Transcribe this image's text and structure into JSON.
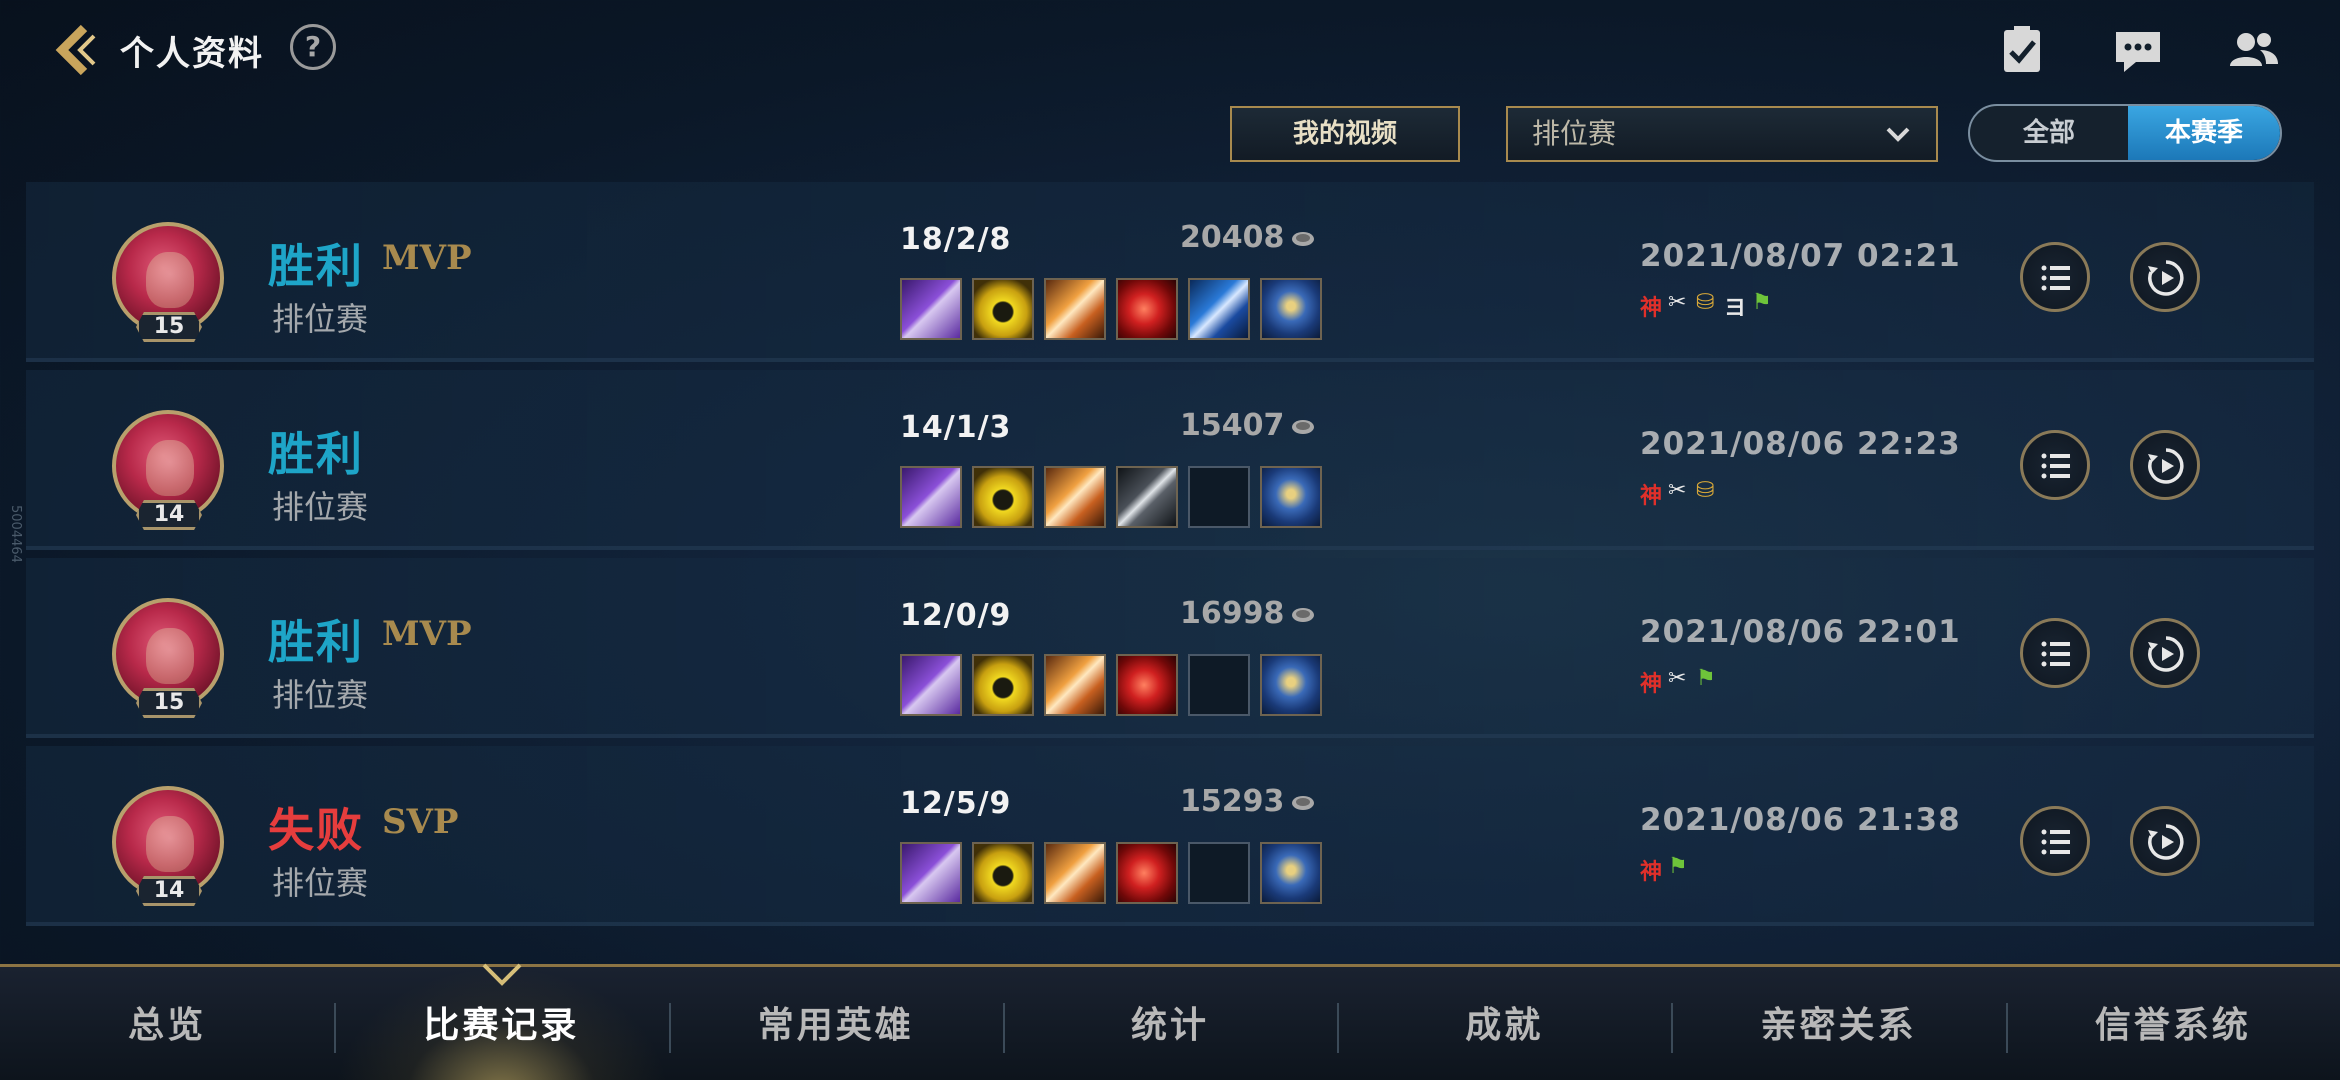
{
  "header": {
    "title": "个人资料",
    "help_label": "?",
    "icons": [
      "clipboard-check-icon",
      "chat-bubble-icon",
      "friends-icon"
    ]
  },
  "filters": {
    "my_videos_label": "我的视频",
    "mode_selected": "排位赛",
    "toggle": {
      "all_label": "全部",
      "season_label": "本赛季",
      "selected": "本赛季"
    }
  },
  "matches": [
    {
      "result": "胜利",
      "outcome": "win",
      "badge": "MVP",
      "mode": "排位赛",
      "level": "15",
      "kda": "18/2/8",
      "gold": "20408",
      "date": "2021/08/07 02:21",
      "items": [
        "purple-blade",
        "yellow-triangle",
        "orange-wings",
        "red-claw",
        "blue-lance",
        "blue-trinket"
      ],
      "tags": [
        {
          "text": "神",
          "color": "#e0302a"
        },
        {
          "text": "✂",
          "color": "#e8e8e8"
        },
        {
          "text": "⛁",
          "color": "#d8a838"
        },
        {
          "text": "ヨ",
          "color": "#e8e8e8"
        },
        {
          "text": "⚑",
          "color": "#6ec43a"
        }
      ]
    },
    {
      "result": "胜利",
      "outcome": "win",
      "badge": "",
      "mode": "排位赛",
      "level": "14",
      "kda": "14/1/3",
      "gold": "15407",
      "date": "2021/08/06 22:23",
      "items": [
        "purple-blade",
        "yellow-triangle",
        "orange-wings",
        "grey-sword",
        "empty",
        "blue-trinket"
      ],
      "tags": [
        {
          "text": "神",
          "color": "#e0302a"
        },
        {
          "text": "✂",
          "color": "#e8e8e8"
        },
        {
          "text": "⛁",
          "color": "#d8a838"
        }
      ]
    },
    {
      "result": "胜利",
      "outcome": "win",
      "badge": "MVP",
      "mode": "排位赛",
      "level": "15",
      "kda": "12/0/9",
      "gold": "16998",
      "date": "2021/08/06 22:01",
      "items": [
        "purple-blade",
        "yellow-triangle",
        "orange-wings",
        "red-claw",
        "empty",
        "blue-trinket"
      ],
      "tags": [
        {
          "text": "神",
          "color": "#e0302a"
        },
        {
          "text": "✂",
          "color": "#e8e8e8"
        },
        {
          "text": "⚑",
          "color": "#6ec43a"
        }
      ]
    },
    {
      "result": "失败",
      "outcome": "loss",
      "badge": "SVP",
      "mode": "排位赛",
      "level": "14",
      "kda": "12/5/9",
      "gold": "15293",
      "date": "2021/08/06 21:38",
      "items": [
        "purple-blade",
        "yellow-triangle",
        "orange-wings",
        "red-claw",
        "empty",
        "blue-trinket"
      ],
      "tags": [
        {
          "text": "神",
          "color": "#e0302a"
        },
        {
          "text": "⚑",
          "color": "#6ec43a"
        }
      ]
    }
  ],
  "bottom_nav": {
    "tabs": [
      "总览",
      "比赛记录",
      "常用英雄",
      "统计",
      "成就",
      "亲密关系",
      "信誉系统"
    ],
    "active_index": 1
  },
  "side_code": "5004464",
  "colors": {
    "win": "#1ea5c8",
    "loss": "#e63d3d",
    "gold_accent": "#a88a4e",
    "active_toggle": "#2a8fd0"
  }
}
